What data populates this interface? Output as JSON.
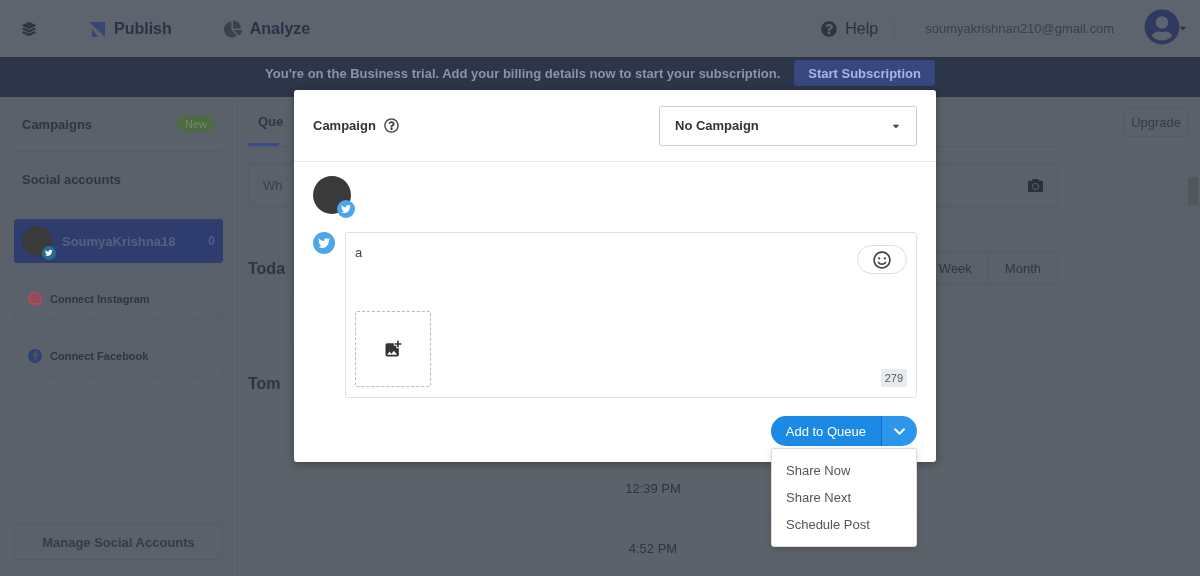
{
  "header": {
    "nav": [
      {
        "label": "Publish",
        "kind": "publish"
      },
      {
        "label": "Analyze",
        "kind": "analyze"
      }
    ],
    "help": "Help",
    "email": "soumyakrishnan210@gmail.com"
  },
  "banner": {
    "text": "You're on the Business trial. Add your billing details now to start your subscription.",
    "button": "Start Subscription"
  },
  "sidebar": {
    "campaigns": {
      "label": "Campaigns",
      "badge": "New"
    },
    "social_heading": "Social accounts",
    "accounts": [
      {
        "name": "SoumyaKrishna18",
        "count": "0",
        "selected": true
      }
    ],
    "connect": [
      {
        "label": "Connect Instagram",
        "kind": "instagram"
      },
      {
        "label": "Connect Facebook",
        "kind": "facebook"
      }
    ],
    "manage_button": "Manage Social Accounts"
  },
  "main": {
    "tab": "Que",
    "composer_placeholder": "Wh",
    "upgrade": "Upgrade",
    "today": "Toda",
    "tomorrow": "Tom",
    "view_tabs": [
      {
        "label": "Week"
      },
      {
        "label": "Month"
      }
    ],
    "times": [
      "12:39 PM",
      "4:52 PM"
    ]
  },
  "modal": {
    "campaign_label": "Campaign",
    "campaign_select": "No Campaign",
    "post_text": "a",
    "char_count": "279",
    "primary_button": "Add to Queue",
    "menu": [
      "Share Now",
      "Share Next",
      "Schedule Post"
    ]
  }
}
